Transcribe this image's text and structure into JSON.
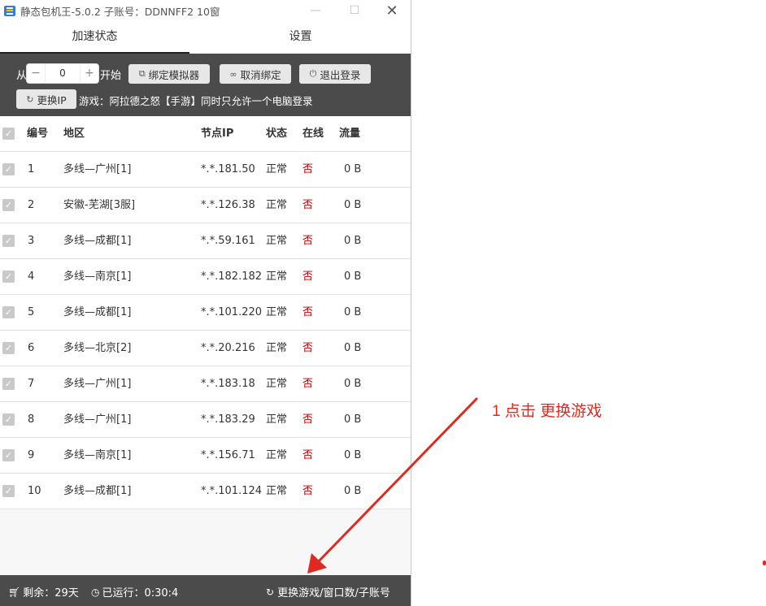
{
  "window": {
    "title": "静态包机王-5.0.2 子账号：DDNNFF2 10窗",
    "min_glyph": "—",
    "max_glyph": "☐",
    "close_glyph": "✕"
  },
  "tabs": [
    {
      "label": "加速状态",
      "active": true
    },
    {
      "label": "设置",
      "active": false
    }
  ],
  "controls": {
    "from_label": "从",
    "stepper_value": "0",
    "minus": "−",
    "plus": "+",
    "start_label": "开始",
    "bind_emulator": "绑定模拟器",
    "unbind": "取消绑定",
    "logout": "退出登录",
    "change_ip": "更换IP",
    "game_info": "游戏：阿拉德之怒【手游】同时只允许一个电脑登录"
  },
  "table": {
    "headers": {
      "no": "编号",
      "region": "地区",
      "ip": "节点IP",
      "status": "状态",
      "online": "在线",
      "traffic": "流量"
    },
    "rows": [
      {
        "no": "1",
        "region": "多线—广州[1]",
        "ip": "*.*.181.50",
        "status": "正常",
        "online": "否",
        "traffic": "0 B"
      },
      {
        "no": "2",
        "region": "安徽-芜湖[3服]",
        "ip": "*.*.126.38",
        "status": "正常",
        "online": "否",
        "traffic": "0 B"
      },
      {
        "no": "3",
        "region": "多线—成都[1]",
        "ip": "*.*.59.161",
        "status": "正常",
        "online": "否",
        "traffic": "0 B"
      },
      {
        "no": "4",
        "region": "多线—南京[1]",
        "ip": "*.*.182.182",
        "status": "正常",
        "online": "否",
        "traffic": "0 B"
      },
      {
        "no": "5",
        "region": "多线—成都[1]",
        "ip": "*.*.101.220",
        "status": "正常",
        "online": "否",
        "traffic": "0 B"
      },
      {
        "no": "6",
        "region": "多线—北京[2]",
        "ip": "*.*.20.216",
        "status": "正常",
        "online": "否",
        "traffic": "0 B"
      },
      {
        "no": "7",
        "region": "多线—广州[1]",
        "ip": "*.*.183.18",
        "status": "正常",
        "online": "否",
        "traffic": "0 B"
      },
      {
        "no": "8",
        "region": "多线—广州[1]",
        "ip": "*.*.183.29",
        "status": "正常",
        "online": "否",
        "traffic": "0 B"
      },
      {
        "no": "9",
        "region": "多线—南京[1]",
        "ip": "*.*.156.71",
        "status": "正常",
        "online": "否",
        "traffic": "0 B"
      },
      {
        "no": "10",
        "region": "多线—成都[1]",
        "ip": "*.*.101.124",
        "status": "正常",
        "online": "否",
        "traffic": "0 B"
      }
    ]
  },
  "footer": {
    "remaining": "剩余：29天",
    "running": "已运行：0:30:4",
    "change": "更换游戏/窗口数/子账号"
  },
  "annotation": {
    "text": "1 点击 更换游戏",
    "color": "#e02a1f"
  }
}
